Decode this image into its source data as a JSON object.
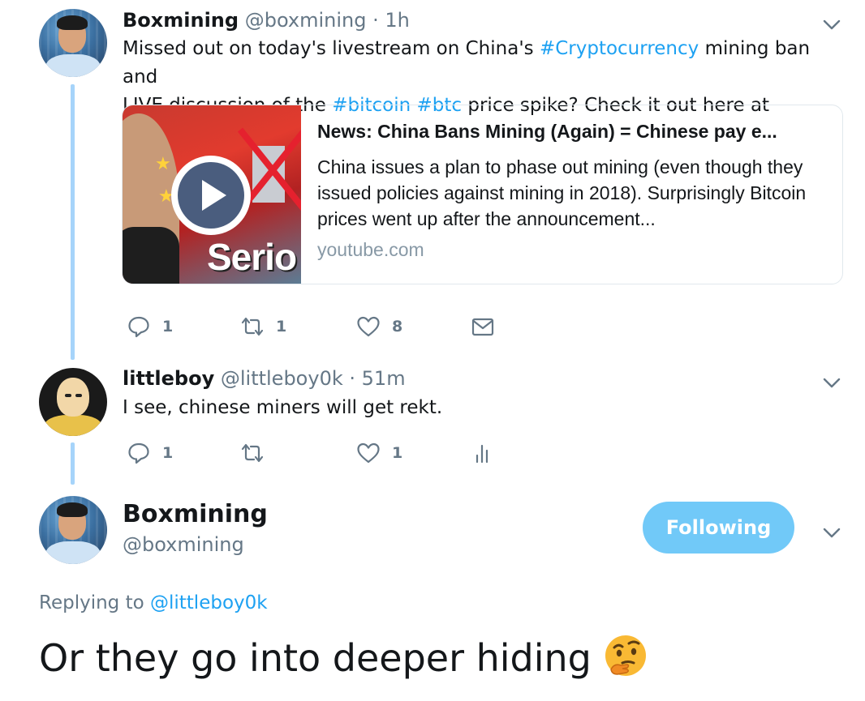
{
  "tweet1": {
    "name": "Boxmining",
    "handle": "@boxmining",
    "time": "· 1h",
    "text_parts": {
      "p1": "Missed out on today's livestream on China's ",
      "h1": "#Cryptocurrency",
      "p2": " mining ban and",
      "p3": "LIVE discussion of the ",
      "h2": "#bitcoin",
      "p4": " ",
      "h3": "#btc",
      "p5": " price spike? Check it out here at"
    },
    "card": {
      "thumb_text": "Serio",
      "title": "News: China Bans Mining (Again) = Chinese pay e...",
      "description": "China issues a plan to phase out mining (even though they issued policies against mining in 2018). Surprisingly Bitcoin prices went up after the announcement...",
      "domain": "youtube.com"
    },
    "actions": {
      "reply_count": "1",
      "retweet_count": "1",
      "like_count": "8"
    }
  },
  "tweet2": {
    "name": "littleboy",
    "handle": "@littleboy0k",
    "time": "· 51m",
    "text": "I see, chinese miners will get rekt.",
    "actions": {
      "reply_count": "1",
      "like_count": "1"
    }
  },
  "main_tweet": {
    "name": "Boxmining",
    "handle": "@boxmining",
    "follow_label": "Following",
    "replying_prefix": "Replying to ",
    "replying_handle": "@littleboy0k",
    "text": "Or they go into deeper hiding",
    "emoji": "thinking-face"
  },
  "icons": {
    "reply": "reply-icon",
    "retweet": "retweet-icon",
    "like": "heart-icon",
    "dm": "envelope-icon",
    "analytics": "analytics-icon",
    "more": "chevron-down-icon"
  },
  "colors": {
    "link": "#1da1f2",
    "thread_line": "#a6d4fa",
    "follow_button": "#71c9f8",
    "muted": "#657786"
  }
}
